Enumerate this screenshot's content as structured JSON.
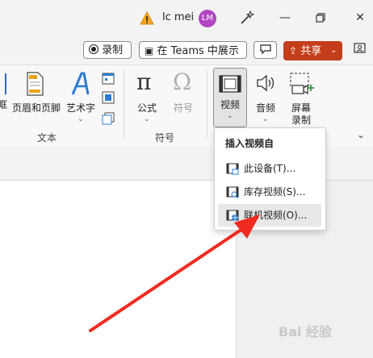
{
  "titlebar": {
    "user_name": "lc mei",
    "avatar_initials": "LM",
    "avatar_color": "#b146c2"
  },
  "command_bar": {
    "record_label": "录制",
    "teams_label": "在 Teams 中展示",
    "share_label": "共享",
    "share_color": "#c43e1c"
  },
  "ribbon": {
    "text_group": {
      "label": "文本",
      "header_footer": "页眉和页脚",
      "wordart": "艺术字",
      "partial_left": "眶"
    },
    "symbols_group": {
      "label": "符号",
      "equation": "公式",
      "symbol": "符号"
    },
    "media_group": {
      "video": "视频",
      "audio": "音频",
      "screen_recording_line1": "屏幕",
      "screen_recording_line2": "录制"
    }
  },
  "video_menu": {
    "title": "插入视频自",
    "items": [
      {
        "label": "此设备(T)..."
      },
      {
        "label": "库存视频(S)..."
      },
      {
        "label": "联机视频(O)..."
      }
    ]
  },
  "annotation": {
    "arrow_color": "#f02a20"
  },
  "watermark": "Bai 经验"
}
